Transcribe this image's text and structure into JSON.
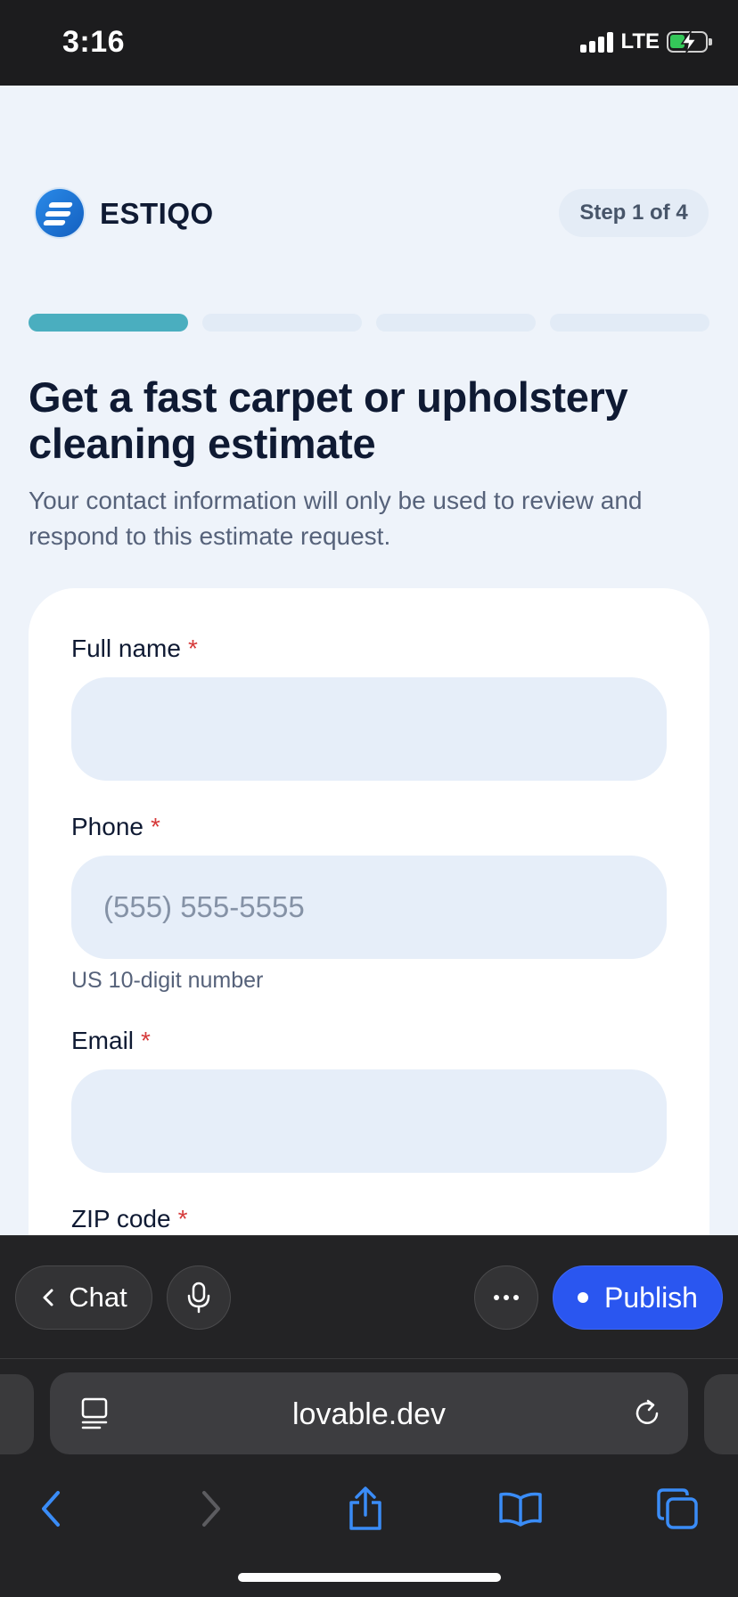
{
  "status_bar": {
    "time": "3:16",
    "network": "LTE"
  },
  "header": {
    "brand": "ESTIQO",
    "step": "Step 1 of 4"
  },
  "progress": {
    "current_step": 1,
    "total_steps": 4
  },
  "intro": {
    "headline": "Get a fast carpet or upholstery cleaning estimate",
    "subtext": "Your contact information will only be used to review and respond to this estimate request."
  },
  "form": {
    "full_name": {
      "label": "Full name",
      "required_mark": "*",
      "value": "",
      "placeholder": ""
    },
    "phone": {
      "label": "Phone",
      "required_mark": "*",
      "value": "",
      "placeholder": "(555) 555-5555",
      "helper": "US 10-digit number"
    },
    "email": {
      "label": "Email",
      "required_mark": "*",
      "value": "",
      "placeholder": ""
    },
    "zip": {
      "label": "ZIP code",
      "required_mark": "*"
    }
  },
  "lovable_bar": {
    "chat_label": "Chat",
    "publish_label": "Publish"
  },
  "browser": {
    "url": "lovable.dev"
  },
  "colors": {
    "accent": "#4aaebf",
    "publish": "#2a56f0",
    "required": "#d63a3a",
    "input_bg": "#e6eef9"
  }
}
